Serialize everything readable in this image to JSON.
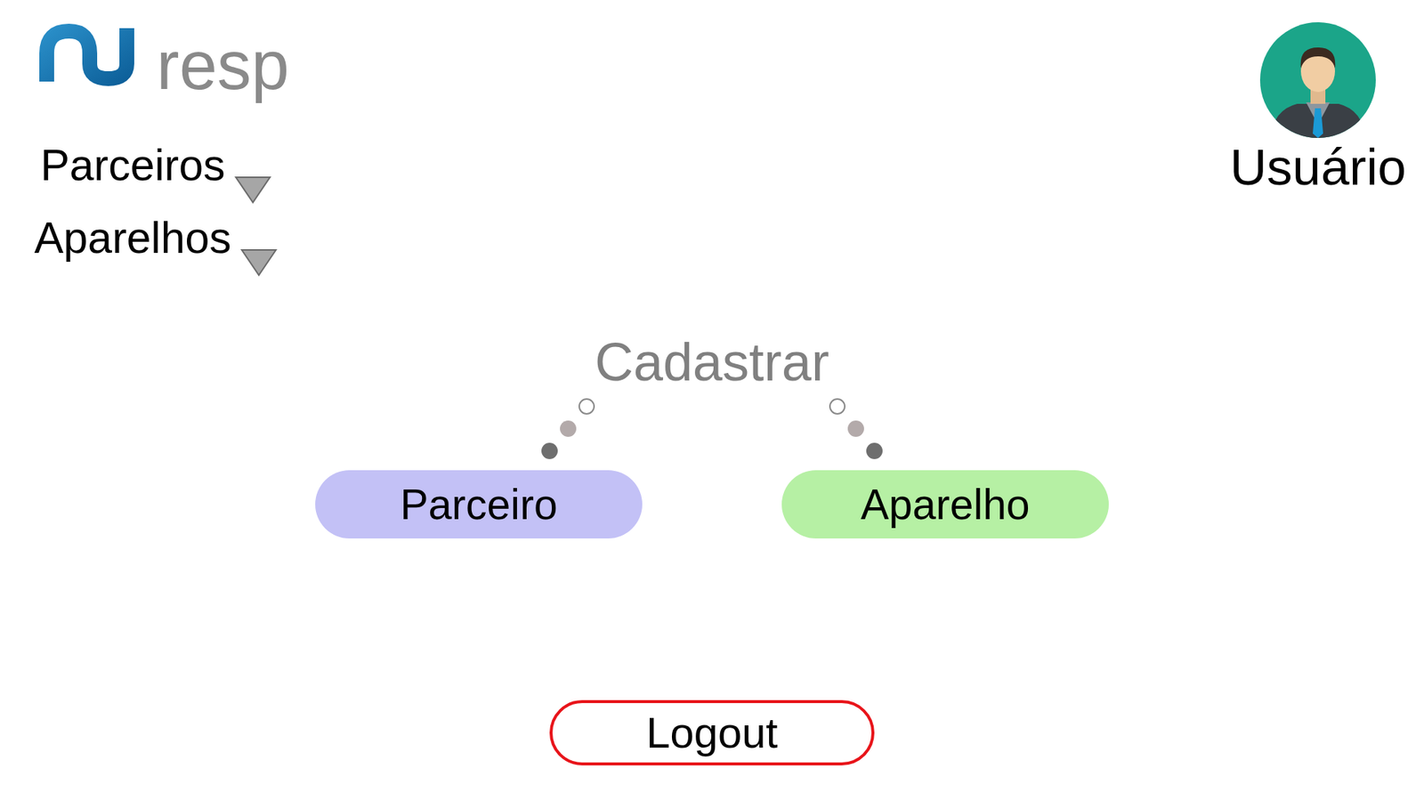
{
  "logo": {
    "text": "resp"
  },
  "nav": [
    {
      "label": "Parceiros",
      "expanded": false
    },
    {
      "label": "Aparelhos",
      "expanded": false
    }
  ],
  "user": {
    "label": "Usuário"
  },
  "register": {
    "title": "Cadastrar",
    "actions": [
      {
        "label": "Parceiro",
        "color": "#c3c1f6"
      },
      {
        "label": "Aparelho",
        "color": "#b6f0a4"
      }
    ]
  },
  "logout": {
    "label": "Logout"
  }
}
